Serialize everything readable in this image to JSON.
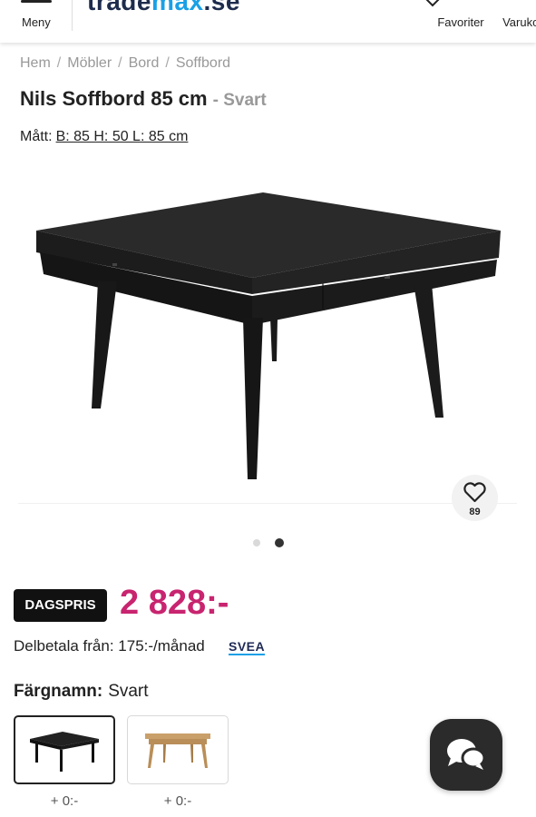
{
  "header": {
    "menu_label": "Meny",
    "logo_part1": "trade",
    "logo_part2": "max",
    "logo_part3": ".se",
    "favorites_label": "Favoriter",
    "cart_label": "Varukorg"
  },
  "breadcrumb": [
    "Hem",
    "Möbler",
    "Bord",
    "Soffbord"
  ],
  "breadcrumb_separator": "/",
  "product": {
    "title": "Nils Soffbord 85 cm",
    "variant": "- Svart",
    "dimensions_label": "Mått:",
    "dimensions_value": "B: 85 H: 50 L: 85 cm",
    "favorite_count": "89",
    "image_icon": "coffee-table-black",
    "carousel_pages": 2,
    "carousel_active": 2
  },
  "price": {
    "badge": "DAGSPRIS",
    "value": "2 828:-",
    "installment_text": "Delbetala från: 175:-/månad",
    "provider": "SVEA"
  },
  "color": {
    "label": "Färgnamn:",
    "value": "Svart",
    "options": [
      {
        "price": "+ 0:-",
        "icon": "table-black-swatch"
      },
      {
        "price": "+ 0:-",
        "icon": "table-oak-swatch"
      }
    ]
  },
  "colors": {
    "price_accent": "#c8246f",
    "badge_bg": "#111111",
    "logo_dark": "#1d2b4c",
    "logo_blue": "#1aa0e6",
    "chat_bg": "#2b2b2b"
  },
  "chat_icon": "chat-bubbles-icon"
}
